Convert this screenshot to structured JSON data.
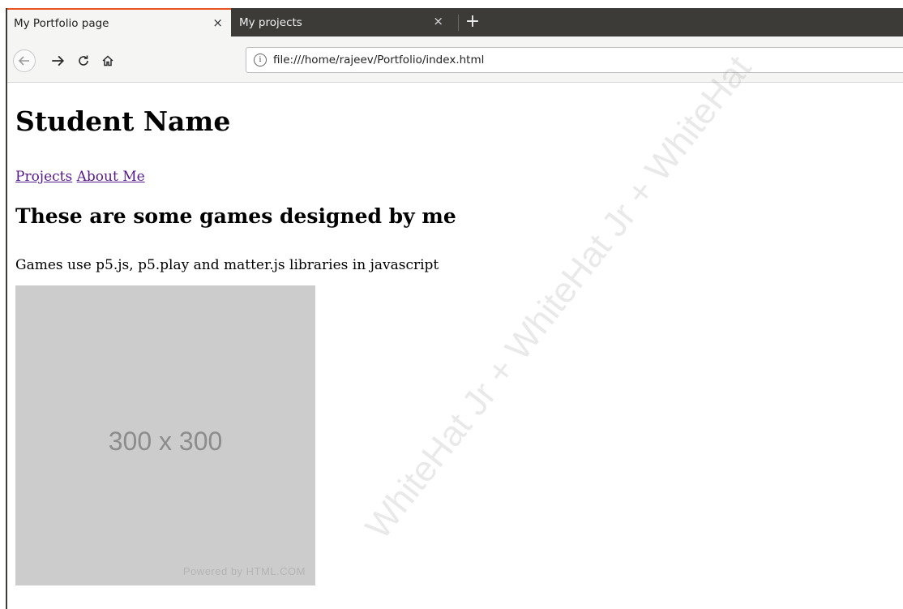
{
  "browser": {
    "tabs": [
      {
        "title": "My Portfolio page",
        "close": "×",
        "active": true
      },
      {
        "title": "My projects",
        "close": "×",
        "active": false
      }
    ],
    "new_tab": "+",
    "nav": {
      "back_icon": "arrow-left-icon",
      "forward_icon": "arrow-right-icon",
      "reload_icon": "reload-icon",
      "home_icon": "home-icon"
    },
    "url_info_icon": "i",
    "url": "file:///home/rajeev/Portfolio/index.html"
  },
  "page": {
    "title": "Student Name",
    "links": [
      "Projects",
      "About Me"
    ],
    "heading": "These are some games designed by me",
    "description": "Games use p5.js, p5.play and matter.js libraries in javascript",
    "image": {
      "label": "300 x 300",
      "credit": "Powered by HTML.COM"
    }
  },
  "watermark": "WhiteHat Jr + WhiteHat Jr + WhiteHat",
  "colors": {
    "tab_strip": "#3c3b37",
    "active_tab_accent": "#e95420",
    "visited_link": "#551a8b",
    "placeholder_bg": "#cccccc"
  }
}
